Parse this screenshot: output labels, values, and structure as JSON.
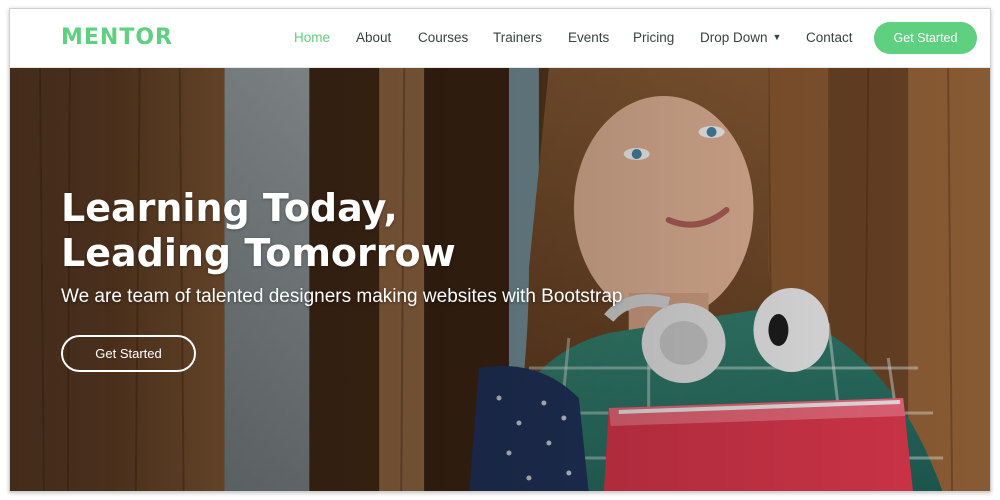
{
  "brand": {
    "logo_text": "MENTOR",
    "accent_color": "#5fcf80"
  },
  "nav": {
    "items": [
      {
        "label": "Home",
        "active": true
      },
      {
        "label": "About"
      },
      {
        "label": "Courses"
      },
      {
        "label": "Trainers"
      },
      {
        "label": "Events"
      },
      {
        "label": "Pricing"
      },
      {
        "label": "Drop Down",
        "icon": "chevron-down-icon"
      },
      {
        "label": "Contact"
      }
    ],
    "cta_label": "Get Started"
  },
  "hero": {
    "title_line1": "Learning Today,",
    "title_line2": "Leading Tomorrow",
    "subtitle": "We are team of talented designers making websites with Bootstrap",
    "button_label": "Get Started"
  }
}
